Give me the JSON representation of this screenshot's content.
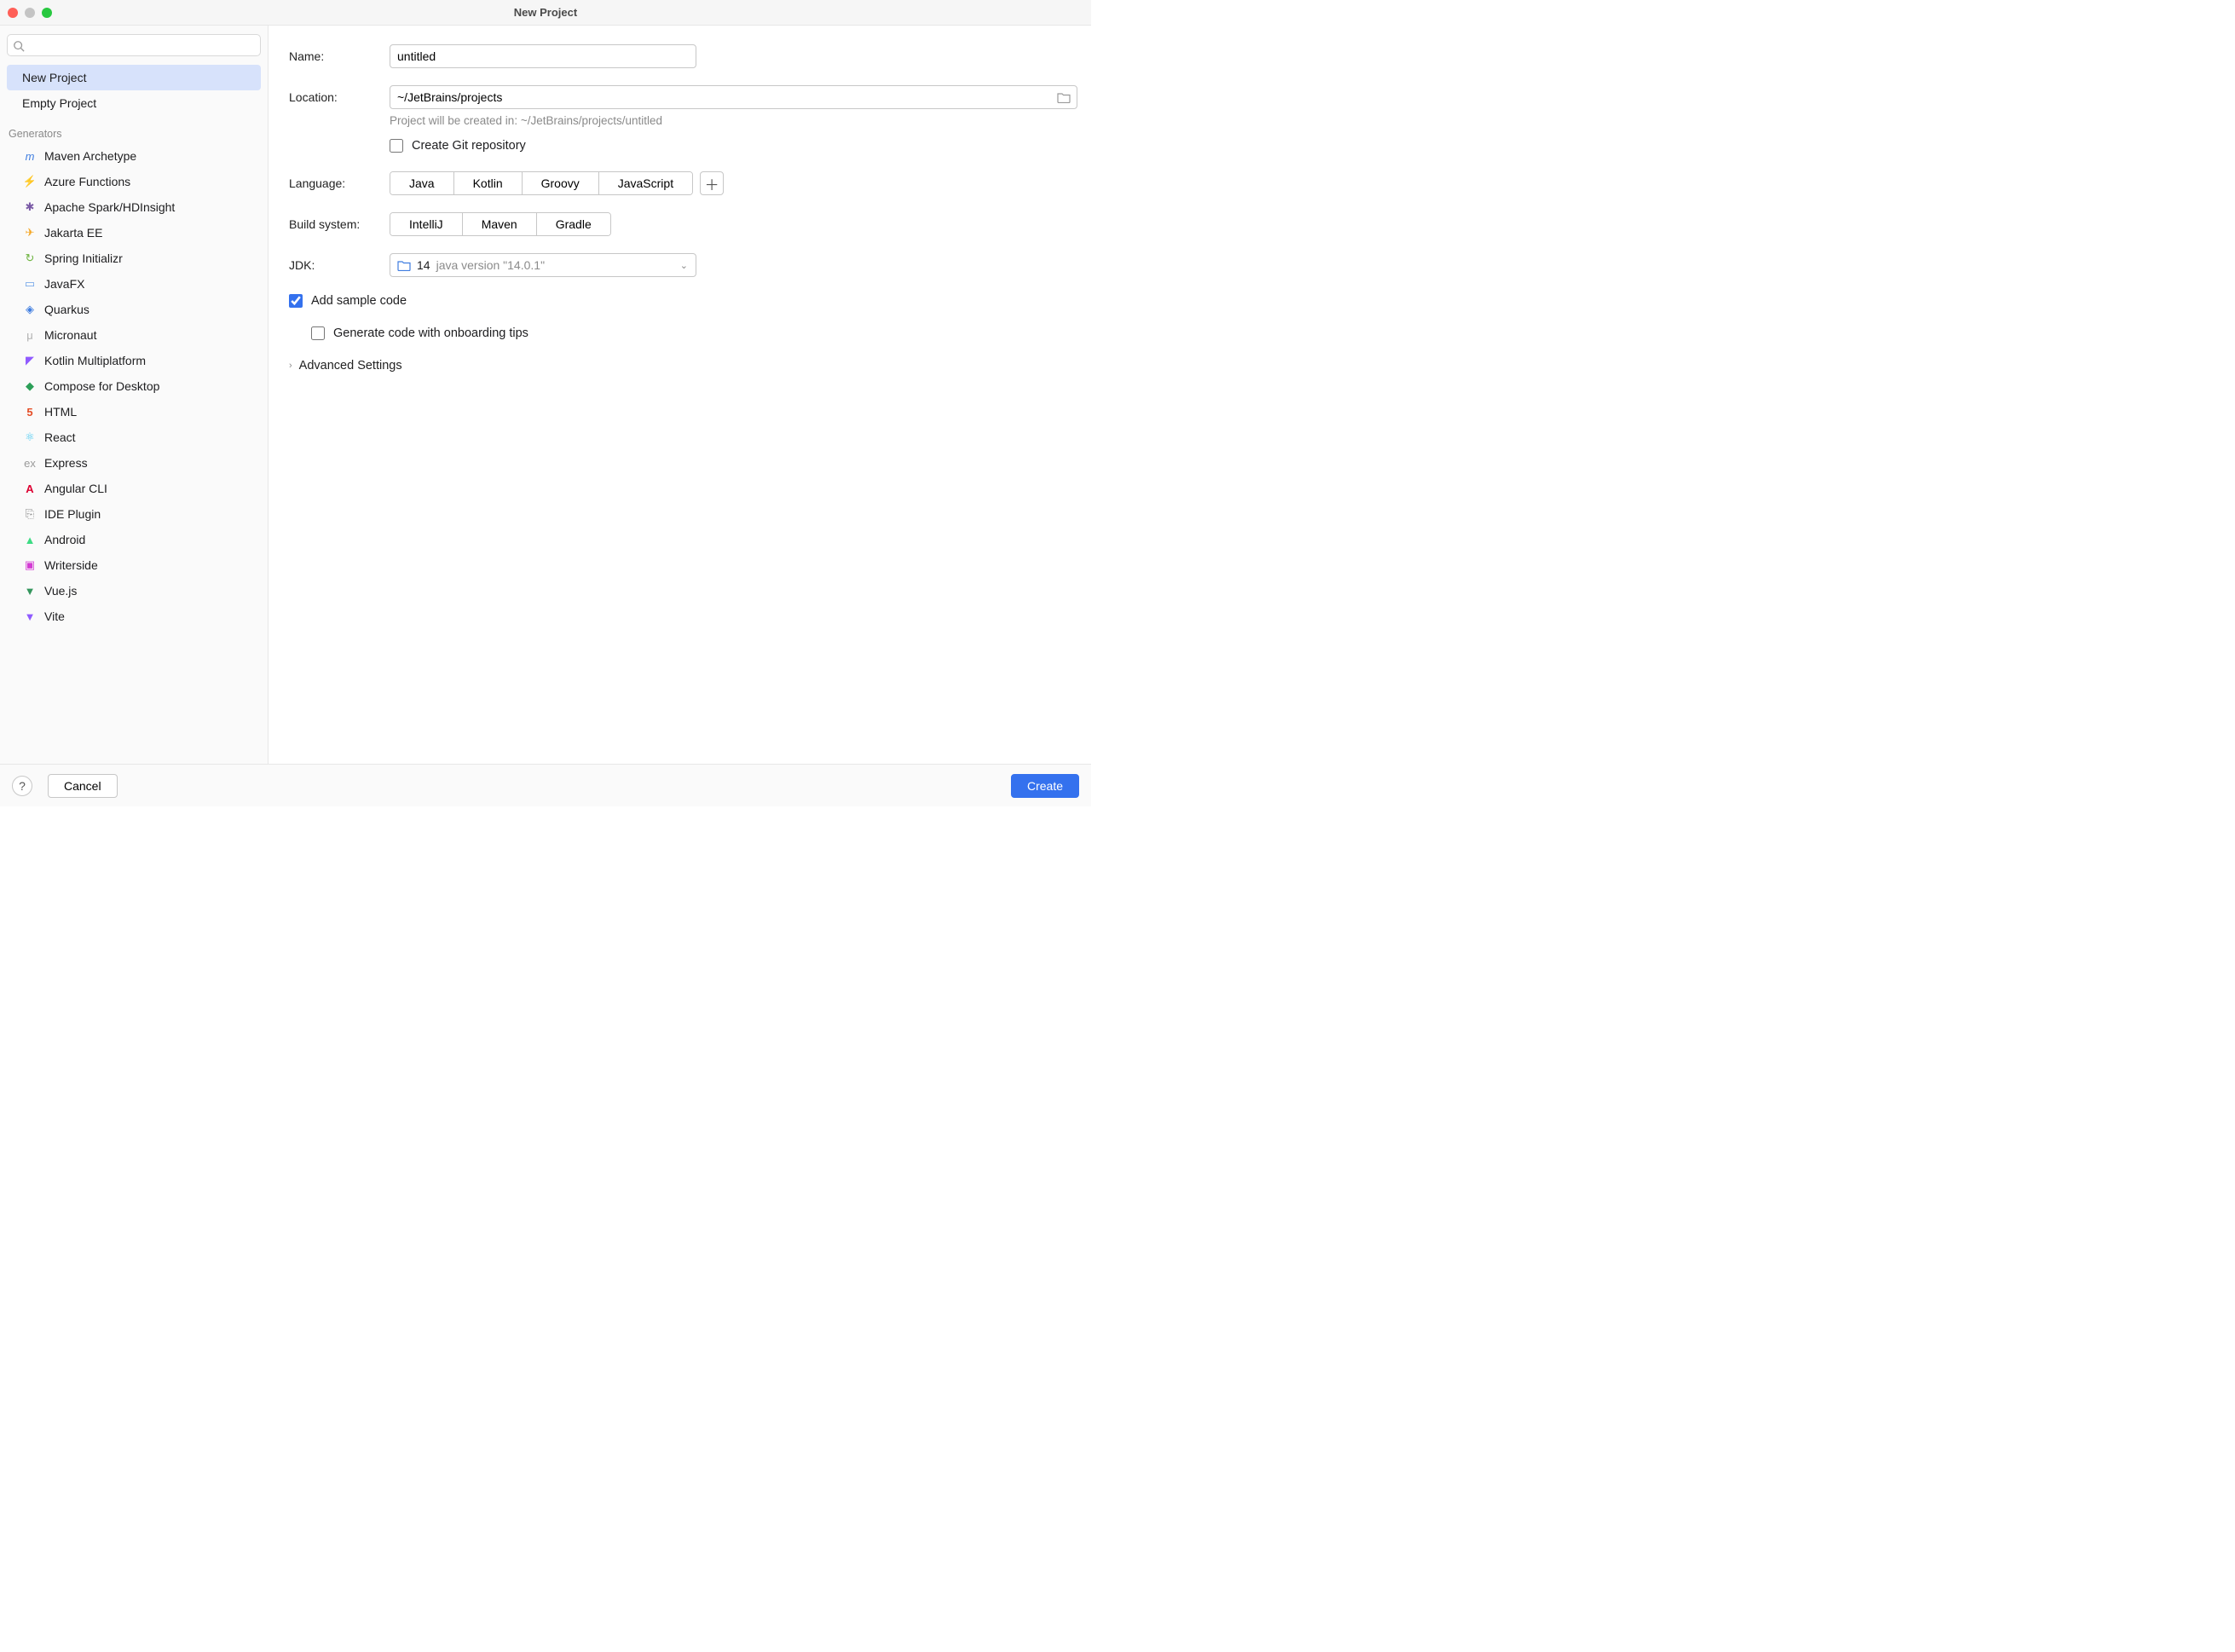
{
  "window": {
    "title": "New Project"
  },
  "sidebar": {
    "search_placeholder": "",
    "top_items": [
      {
        "label": "New Project"
      },
      {
        "label": "Empty Project"
      }
    ],
    "generators_header": "Generators",
    "generators": [
      {
        "label": "Maven Archetype",
        "icon": "maven-icon"
      },
      {
        "label": "Azure Functions",
        "icon": "azure-icon"
      },
      {
        "label": "Apache Spark/HDInsight",
        "icon": "spark-icon"
      },
      {
        "label": "Jakarta EE",
        "icon": "jakarta-icon"
      },
      {
        "label": "Spring Initializr",
        "icon": "spring-icon"
      },
      {
        "label": "JavaFX",
        "icon": "javafx-icon"
      },
      {
        "label": "Quarkus",
        "icon": "quarkus-icon"
      },
      {
        "label": "Micronaut",
        "icon": "micronaut-icon"
      },
      {
        "label": "Kotlin Multiplatform",
        "icon": "kotlin-icon"
      },
      {
        "label": "Compose for Desktop",
        "icon": "compose-icon"
      },
      {
        "label": "HTML",
        "icon": "html-icon"
      },
      {
        "label": "React",
        "icon": "react-icon"
      },
      {
        "label": "Express",
        "icon": "express-icon"
      },
      {
        "label": "Angular CLI",
        "icon": "angular-icon"
      },
      {
        "label": "IDE Plugin",
        "icon": "ide-plugin-icon"
      },
      {
        "label": "Android",
        "icon": "android-icon"
      },
      {
        "label": "Writerside",
        "icon": "writerside-icon"
      },
      {
        "label": "Vue.js",
        "icon": "vue-icon"
      },
      {
        "label": "Vite",
        "icon": "vite-icon"
      }
    ]
  },
  "main": {
    "name": {
      "label": "Name:",
      "value": "untitled"
    },
    "location": {
      "label": "Location:",
      "value": "~/JetBrains/projects",
      "hint": "Project will be created in: ~/JetBrains/projects/untitled"
    },
    "git": {
      "label": "Create Git repository",
      "checked": false
    },
    "language": {
      "label": "Language:",
      "options": [
        "Java",
        "Kotlin",
        "Groovy",
        "JavaScript"
      ],
      "selected": "Java"
    },
    "build_system": {
      "label": "Build system:",
      "options": [
        "IntelliJ",
        "Maven",
        "Gradle"
      ],
      "selected": "IntelliJ"
    },
    "jdk": {
      "label": "JDK:",
      "selected_ver": "14",
      "selected_desc": "java version \"14.0.1\""
    },
    "sample_code": {
      "label": "Add sample code",
      "checked": true
    },
    "onboarding": {
      "label": "Generate code with onboarding tips",
      "checked": false
    },
    "advanced": {
      "label": "Advanced Settings"
    }
  },
  "footer": {
    "cancel": "Cancel",
    "create": "Create"
  },
  "colors": {
    "accent": "#3471ee"
  }
}
